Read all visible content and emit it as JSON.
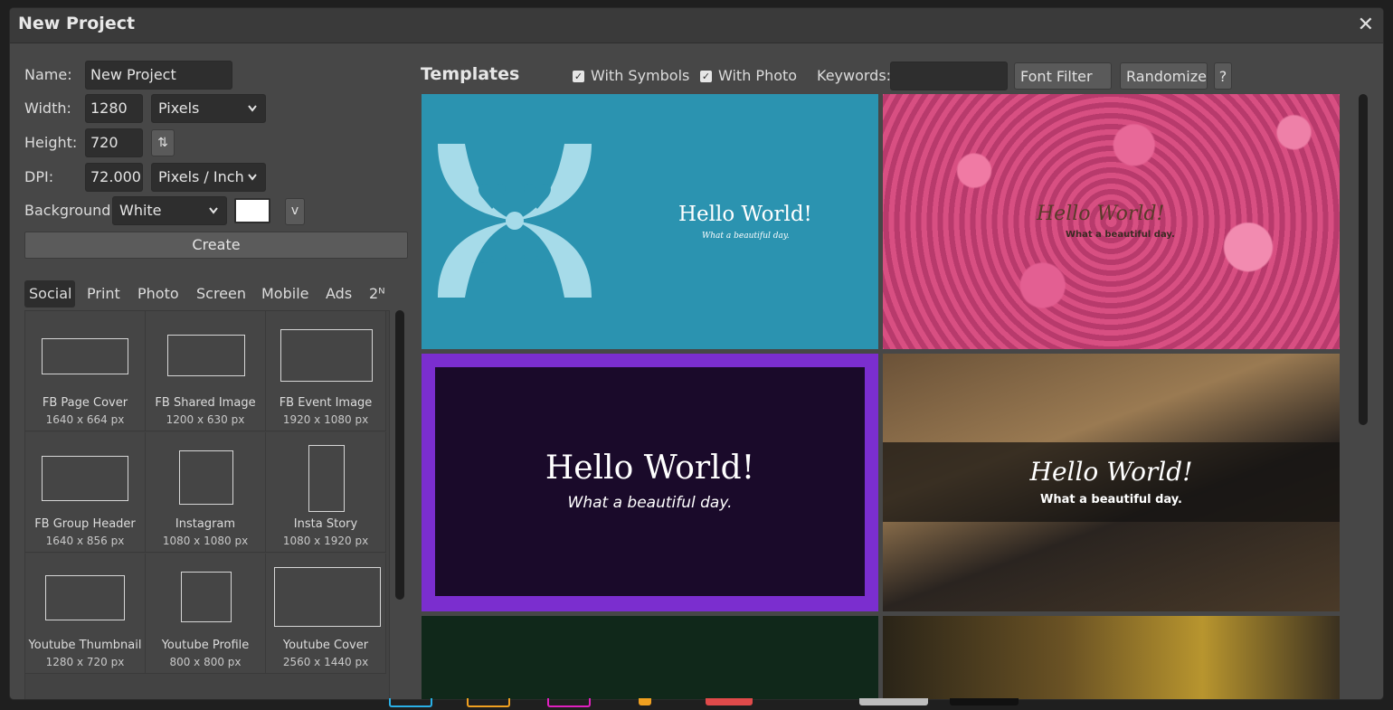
{
  "dialog": {
    "title": "New Project",
    "close_glyph": "✕"
  },
  "form": {
    "name_label": "Name:",
    "name_value": "New Project",
    "width_label": "Width:",
    "width_value": "1280",
    "unit_value": "Pixels",
    "height_label": "Height:",
    "height_value": "720",
    "swap_glyph": "⇅",
    "dpi_label": "DPI:",
    "dpi_value": "72.000",
    "dpi_unit_value": "Pixels / Inch",
    "background_label": "Background:",
    "background_value": "White",
    "background_color": "#ffffff",
    "more_label": "v",
    "create_label": "Create",
    "chevron": "⌄"
  },
  "tabs": [
    "Social",
    "Print",
    "Photo",
    "Screen",
    "Mobile",
    "Ads",
    "2ᴺ"
  ],
  "presets": [
    {
      "name": "FB Page Cover",
      "size": "1640 x 664 px"
    },
    {
      "name": "FB Shared Image",
      "size": "1200 x 630 px"
    },
    {
      "name": "FB Event Image",
      "size": "1920 x 1080 px"
    },
    {
      "name": "FB Group Header",
      "size": "1640 x 856 px"
    },
    {
      "name": "Instagram",
      "size": "1080 x 1080 px"
    },
    {
      "name": "Insta Story",
      "size": "1080 x 1920 px"
    },
    {
      "name": "Youtube Thumbnail",
      "size": "1280 x 720 px"
    },
    {
      "name": "Youtube Profile",
      "size": "800 x 800 px"
    },
    {
      "name": "Youtube Cover",
      "size": "2560 x 1440 px"
    }
  ],
  "templates": {
    "heading": "Templates",
    "with_symbols": "With Symbols",
    "with_photo": "With Photo",
    "keywords_label": "Keywords:",
    "keywords_value": "",
    "font_filter": "Font Filter ▼",
    "randomize": "Randomize",
    "help": "?",
    "check_glyph": "✓",
    "cards": [
      {
        "title": "Hello World!",
        "subtitle": "What a beautiful day.",
        "bg": "#2b93b0",
        "icon": "flower-icon"
      },
      {
        "title": "Hello World!",
        "subtitle": "What a beautiful day.",
        "bg": "#c84f7b",
        "icon": "raspberries-photo"
      },
      {
        "title": "Hello World!",
        "subtitle": "What a beautiful day.",
        "bg": "#7b2ecf"
      },
      {
        "title": "Hello World!",
        "subtitle": "What a beautiful day.",
        "bg": "#3a3228",
        "icon": "lioness-photo"
      }
    ]
  }
}
